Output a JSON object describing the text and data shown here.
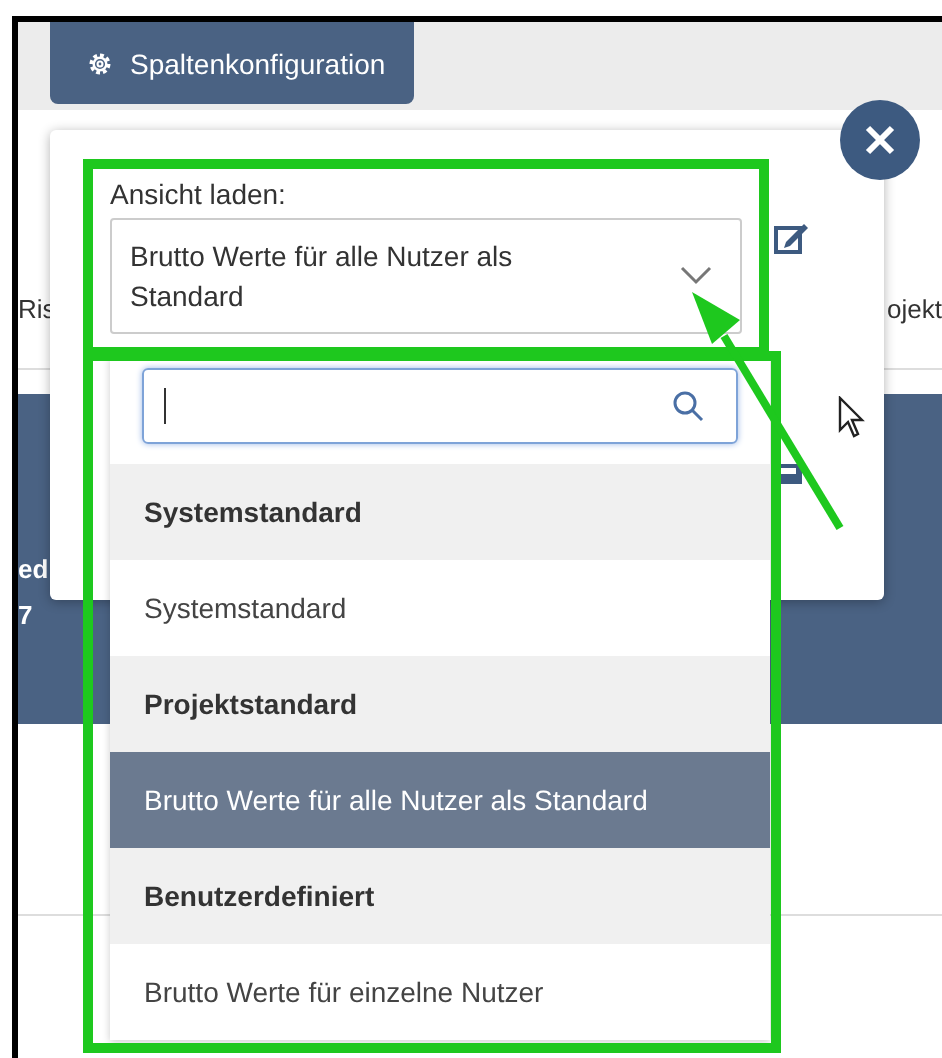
{
  "tab": {
    "label": "Spaltenkonfiguration",
    "selected": true
  },
  "background": {
    "left_text": "Ris",
    "right_text": "ojekt",
    "header_texts": [
      "ed",
      "7"
    ]
  },
  "popup": {
    "label": "Ansicht laden:",
    "select_value": "Brutto Werte für alle Nutzer als Standard"
  },
  "options": [
    {
      "kind": "group",
      "label": "Systemstandard",
      "selected": false
    },
    {
      "kind": "option",
      "label": "Systemstandard",
      "selected": false
    },
    {
      "kind": "group",
      "label": "Projektstandard",
      "selected": false
    },
    {
      "kind": "option",
      "label": "Brutto Werte für alle Nutzer als Standard",
      "selected": true
    },
    {
      "kind": "group",
      "label": "Benutzerdefiniert",
      "selected": false
    },
    {
      "kind": "option",
      "label": "Brutto Werte für einzelne Nutzer",
      "selected": false
    }
  ]
}
